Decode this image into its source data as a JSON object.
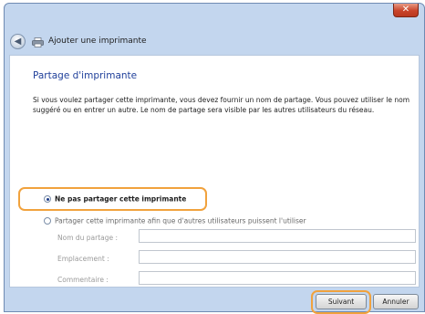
{
  "window": {
    "title": "Ajouter une imprimante",
    "close_label": "✕"
  },
  "page": {
    "heading": "Partage d'imprimante",
    "description": "Si vous voulez partager cette imprimante, vous devez fournir un nom de partage. Vous pouvez utiliser le nom suggéré ou en entrer un autre. Le nom de partage sera visible par les autres utilisateurs du réseau."
  },
  "options": {
    "no_share_label": "Ne pas partager cette imprimante",
    "no_share_selected": true,
    "share_label": "Partager cette imprimante afin que d'autres utilisateurs puissent l'utiliser",
    "share_selected": false
  },
  "fields": [
    {
      "label": "Nom du partage :",
      "value": ""
    },
    {
      "label": "Emplacement :",
      "value": ""
    },
    {
      "label": "Commentaire :",
      "value": ""
    }
  ],
  "buttons": {
    "next_label": "Suivant",
    "cancel_label": "Annuler"
  },
  "icons": {
    "back": "back-arrow-icon",
    "printer": "printer-icon",
    "close": "close-icon"
  },
  "colors": {
    "heading": "#1f3f9a",
    "highlight": "#f1a23d",
    "frame": "#c3d6ee"
  }
}
